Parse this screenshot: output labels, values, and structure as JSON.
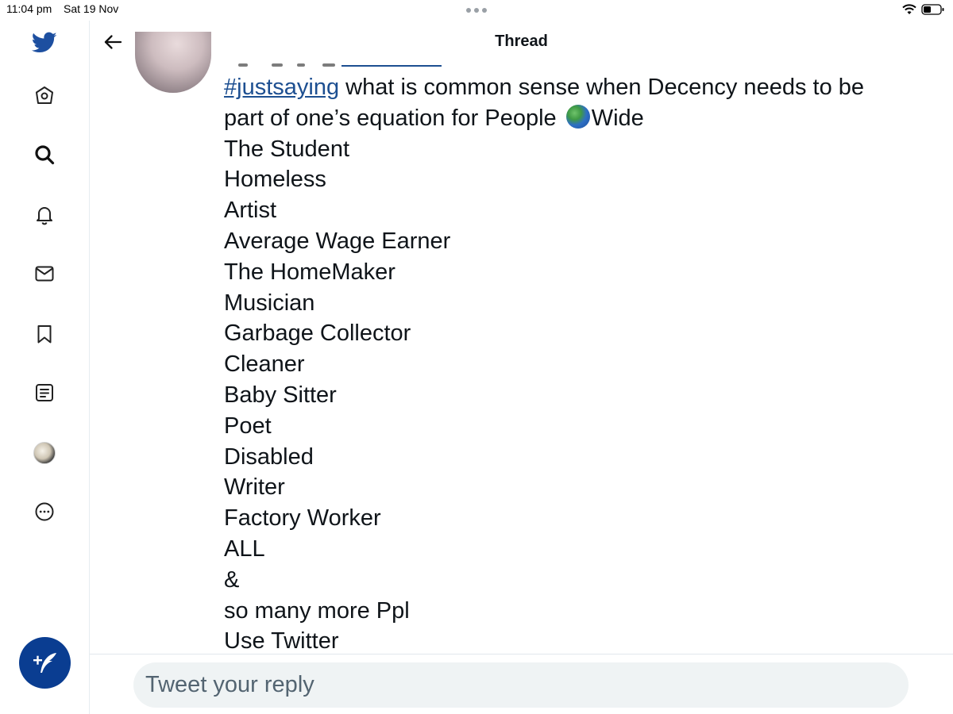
{
  "status_bar": {
    "time": "11:04 pm",
    "date": "Sat 19 Nov"
  },
  "header": {
    "title": "Thread"
  },
  "sidebar": {
    "items": [
      {
        "name": "twitter-logo-icon"
      },
      {
        "name": "home-icon"
      },
      {
        "name": "search-icon"
      },
      {
        "name": "notifications-bell-icon"
      },
      {
        "name": "messages-mail-icon"
      },
      {
        "name": "bookmark-icon"
      },
      {
        "name": "lists-icon"
      },
      {
        "name": "profile-avatar"
      },
      {
        "name": "more-icon"
      }
    ],
    "compose_icon": "compose-tweet-icon"
  },
  "tweet": {
    "hashtag": "#justsaying",
    "first_line_rest": " what is common sense when Decency needs to be",
    "second_line_before": "part of one’s equation for People ",
    "emoji_name": "globe-asia-australia-icon",
    "second_line_after": "Wide",
    "list_lines": [
      "The Student",
      "Homeless",
      "Artist",
      "Average Wage Earner",
      "The HomeMaker",
      "Musician",
      "Garbage Collector",
      "Cleaner",
      "Baby Sitter",
      "Poet",
      "Disabled",
      "Writer",
      "Factory Worker",
      "ALL",
      "&",
      "so many more Ppl",
      "Use Twitter"
    ]
  },
  "reply": {
    "placeholder": "Tweet your reply"
  },
  "colors": {
    "accent": "#1d9bf0",
    "link": "#1d4f91",
    "compose_button": "#0a3d91",
    "text": "#0f1419"
  }
}
